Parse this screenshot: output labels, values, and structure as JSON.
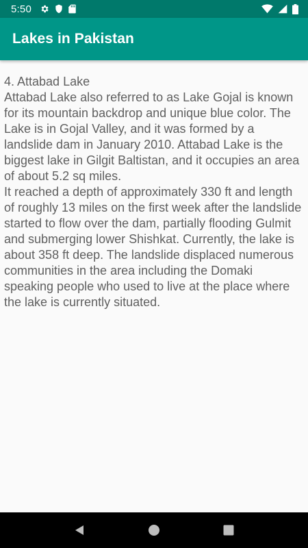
{
  "status_bar": {
    "time": "5:50",
    "left_icons": [
      "settings-icon",
      "shield-icon",
      "sd-card-icon"
    ],
    "right_icons": [
      "wifi-icon",
      "cell-signal-icon",
      "battery-icon"
    ]
  },
  "app_bar": {
    "title": "Lakes in Pakistan"
  },
  "content": {
    "text": "4. Attabad Lake\n Attabad Lake also referred to as Lake Gojal is known for its mountain backdrop and unique blue color. The Lake is in Gojal Valley, and it was formed by a landslide dam in January 2010. Attabad Lake is the biggest lake in Gilgit Baltistan, and it occupies an area of about 5.2 sq miles.\nIt reached a depth of approximately 330 ft and length of roughly 13 miles on the first week after the landslide started to flow over the dam, partially flooding Gulmit and submerging lower Shishkat. Currently, the lake is about 358 ft deep. The landslide displaced numerous communities in the area including the Domaki speaking people who used to live at the place where the lake is currently situated."
  },
  "nav_bar": {
    "buttons": [
      "back-icon",
      "home-icon",
      "recents-icon"
    ]
  },
  "colors": {
    "status_bar": "#00796b",
    "app_bar": "#009688",
    "background": "#fafafa",
    "text": "#5f5f5f",
    "nav_bar": "#000000"
  }
}
